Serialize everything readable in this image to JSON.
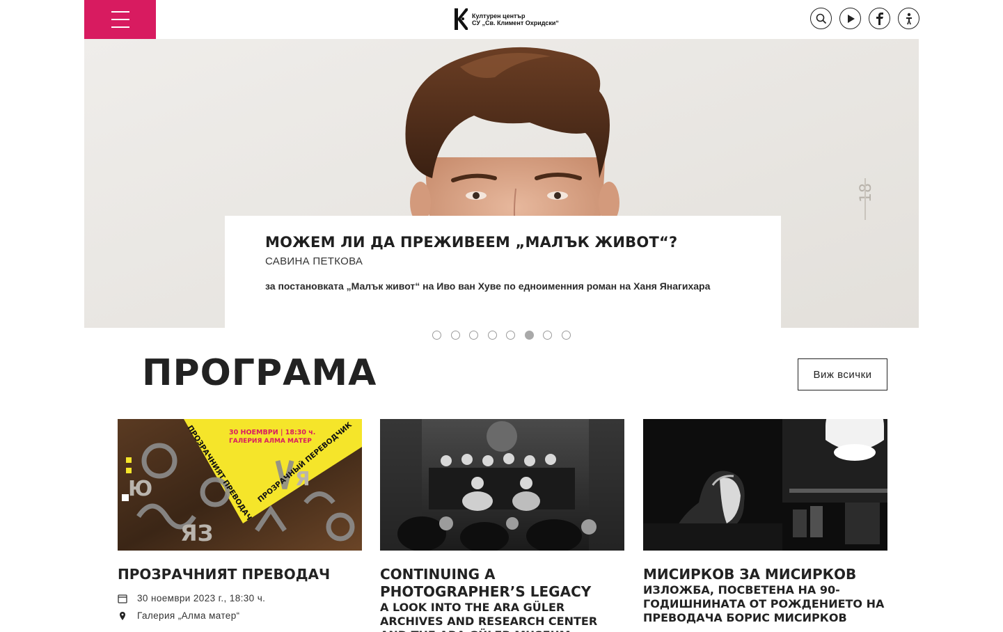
{
  "header": {
    "logo_line1": "Културен център",
    "logo_line2": "СУ „Св. Климент Охридски“",
    "icons": [
      "menu-icon",
      "search-icon",
      "play-icon",
      "facebook-icon",
      "accessibility-icon"
    ]
  },
  "hero": {
    "title": "МОЖЕМ ЛИ ДА ПРЕЖИВЕЕМ „МАЛЪК ЖИВОТ“?",
    "author": "Савина Петкова",
    "description": "за постановката „Малък живот“ на Иво ван Хуве по едноименния роман на Ханя Янагихара",
    "slides_total": 8,
    "active_slide": 6
  },
  "program": {
    "heading": "ПРОГРАМА",
    "see_all": "Виж всички",
    "cards": [
      {
        "title": "ПРОЗРАЧНИЯТ ПРЕВОДАЧ",
        "subtitle": "",
        "date": "30 ноември 2023 г., 18:30 ч.",
        "location": "Галерия „Алма матер“",
        "poster_line1": "30 НОЕМВРИ | 18:30 ч.",
        "poster_line2": "ГАЛЕРИЯ АЛМА МАТЕР",
        "poster_diag1": "ПРОЗРАЧНИЯТ ПРЕВОДАЧ",
        "poster_diag2": "ПРОЗРАЧНЫЙ ПЕРЕВОДЧИК"
      },
      {
        "title": "CONTINUING A PHOTOGRAPHER’S LEGACY",
        "subtitle": "A LOOK INTO THE ARA GÜLER ARCHIVES AND RESEARCH CENTER AND THE ARA GÜLER MUSEUM"
      },
      {
        "title": "МИСИРКОВ ЗА МИСИРКОВ",
        "subtitle": "ИЗЛОЖБА, ПОСВЕТЕНА НА 90-ГОДИШНИНАТА ОТ РОЖДЕНИЕТО НА ПРЕВОДАЧА БОРИС МИСИРКОВ"
      }
    ]
  },
  "colors": {
    "accent": "#d81b60",
    "text": "#222222",
    "poster_yellow": "#f5e52a"
  }
}
